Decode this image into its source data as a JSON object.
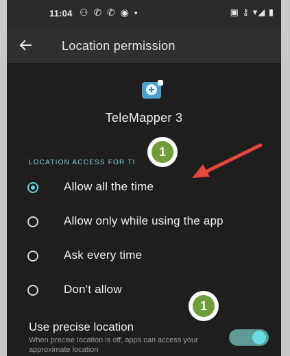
{
  "status_bar": {
    "time": "11:04",
    "left_icons": "⚇ ✆ ✆ ◉ •",
    "right_icons": "▣ ⚷ ▾◢ ▮"
  },
  "header": {
    "back_icon": "back-arrow-icon",
    "title": "Location permission"
  },
  "app": {
    "icon": "map-pin-icon",
    "name": "TeleMapper 3"
  },
  "section": {
    "label": "LOCATION ACCESS FOR TI"
  },
  "options": [
    {
      "label": "Allow all the time",
      "selected": true
    },
    {
      "label": "Allow only while using the app",
      "selected": false
    },
    {
      "label": "Ask every time",
      "selected": false
    },
    {
      "label": "Don't allow",
      "selected": false
    }
  ],
  "precise": {
    "title": "Use precise location",
    "subtitle": "When precise location is off, apps can access your approximate location",
    "enabled": true
  },
  "annotations": [
    {
      "number": "1"
    },
    {
      "number": "1"
    }
  ],
  "colors": {
    "accent": "#63d3d8",
    "arrow": "#e8463a",
    "badge": "#6d9e3a"
  }
}
